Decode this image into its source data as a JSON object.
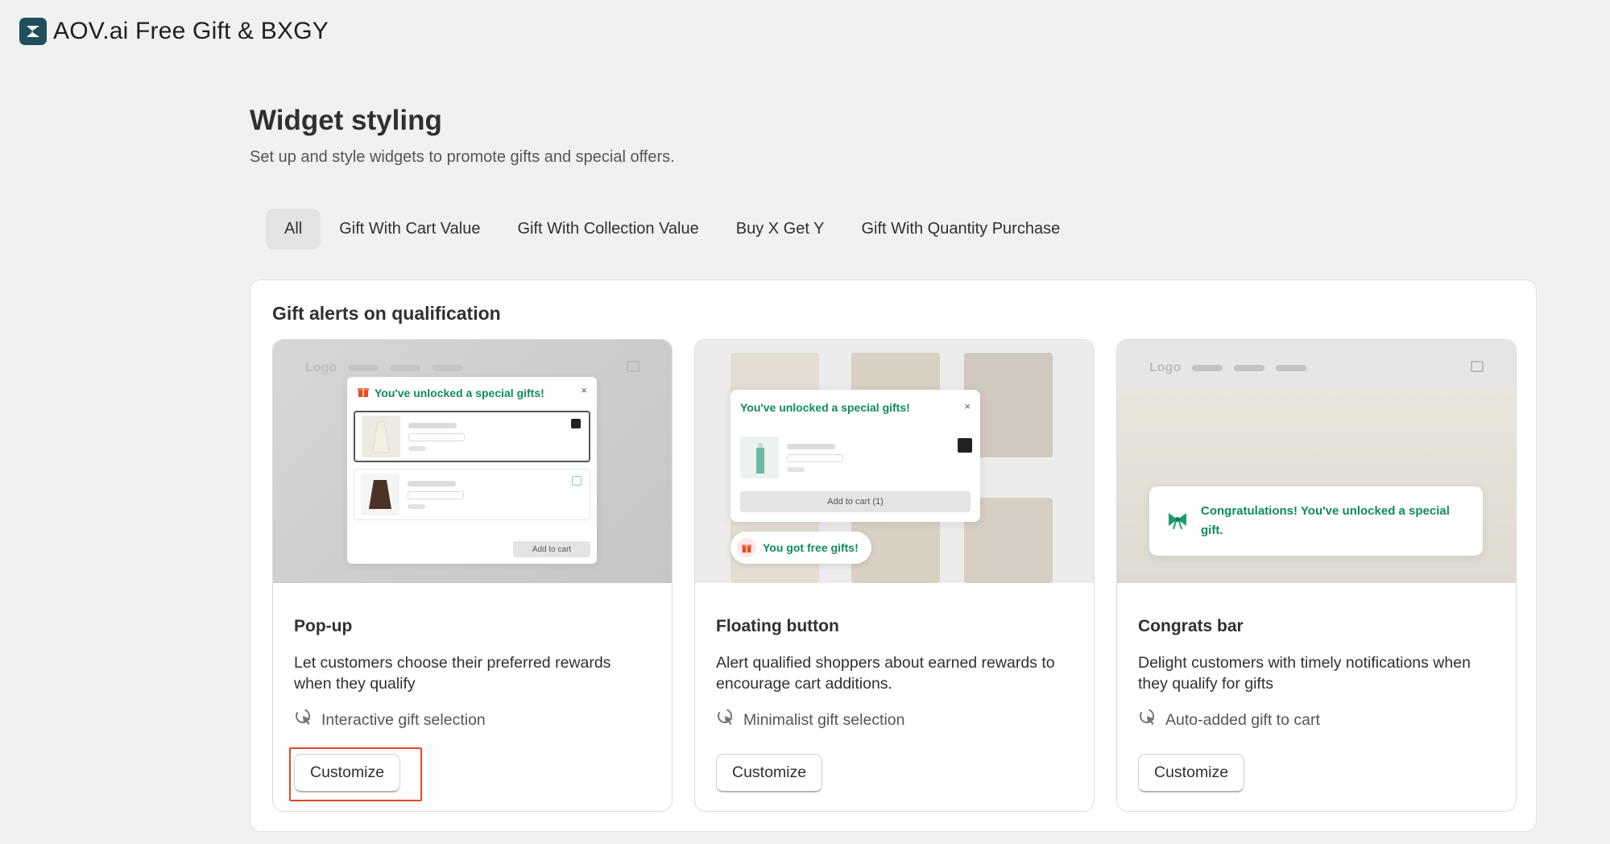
{
  "app": {
    "title": "AOV.ai Free Gift & BXGY"
  },
  "page": {
    "title": "Widget styling",
    "subtitle": "Set up and style widgets to promote gifts and special offers."
  },
  "tabs": [
    {
      "label": "All",
      "active": true
    },
    {
      "label": "Gift With Cart Value"
    },
    {
      "label": "Gift With Collection Value"
    },
    {
      "label": "Buy X Get Y"
    },
    {
      "label": "Gift With Quantity Purchase"
    }
  ],
  "section": {
    "title": "Gift alerts on qualification",
    "cards": [
      {
        "title": "Pop-up",
        "description": "Let customers choose their preferred rewards when they qualify",
        "feature": "Interactive gift selection",
        "feature_icon": "pointer-click-icon",
        "button": "Customize",
        "preview": {
          "nav_logo": "Logo",
          "heading": "You've unlocked a special gifts!",
          "close": "×",
          "add_button": "Add to cart"
        }
      },
      {
        "title": "Floating button",
        "description": "Alert qualified shoppers about earned rewards to encourage cart additions.",
        "feature": "Minimalist gift selection",
        "feature_icon": "pointer-click-icon",
        "button": "Customize",
        "preview": {
          "heading": "You've unlocked a special gifts!",
          "close": "×",
          "add_button": "Add to cart (1)",
          "floating_label": "You got free gifts!"
        }
      },
      {
        "title": "Congrats bar",
        "description": "Delight customers with timely notifications when they qualify for gifts",
        "feature": "Auto-added gift to cart",
        "feature_icon": "pointer-click-icon",
        "button": "Customize",
        "preview": {
          "nav_logo": "Logo",
          "message": "Congratulations! You've unlocked a special gift."
        }
      }
    ]
  },
  "colors": {
    "accent": "#0e8a60",
    "highlight": "#e0472a"
  }
}
